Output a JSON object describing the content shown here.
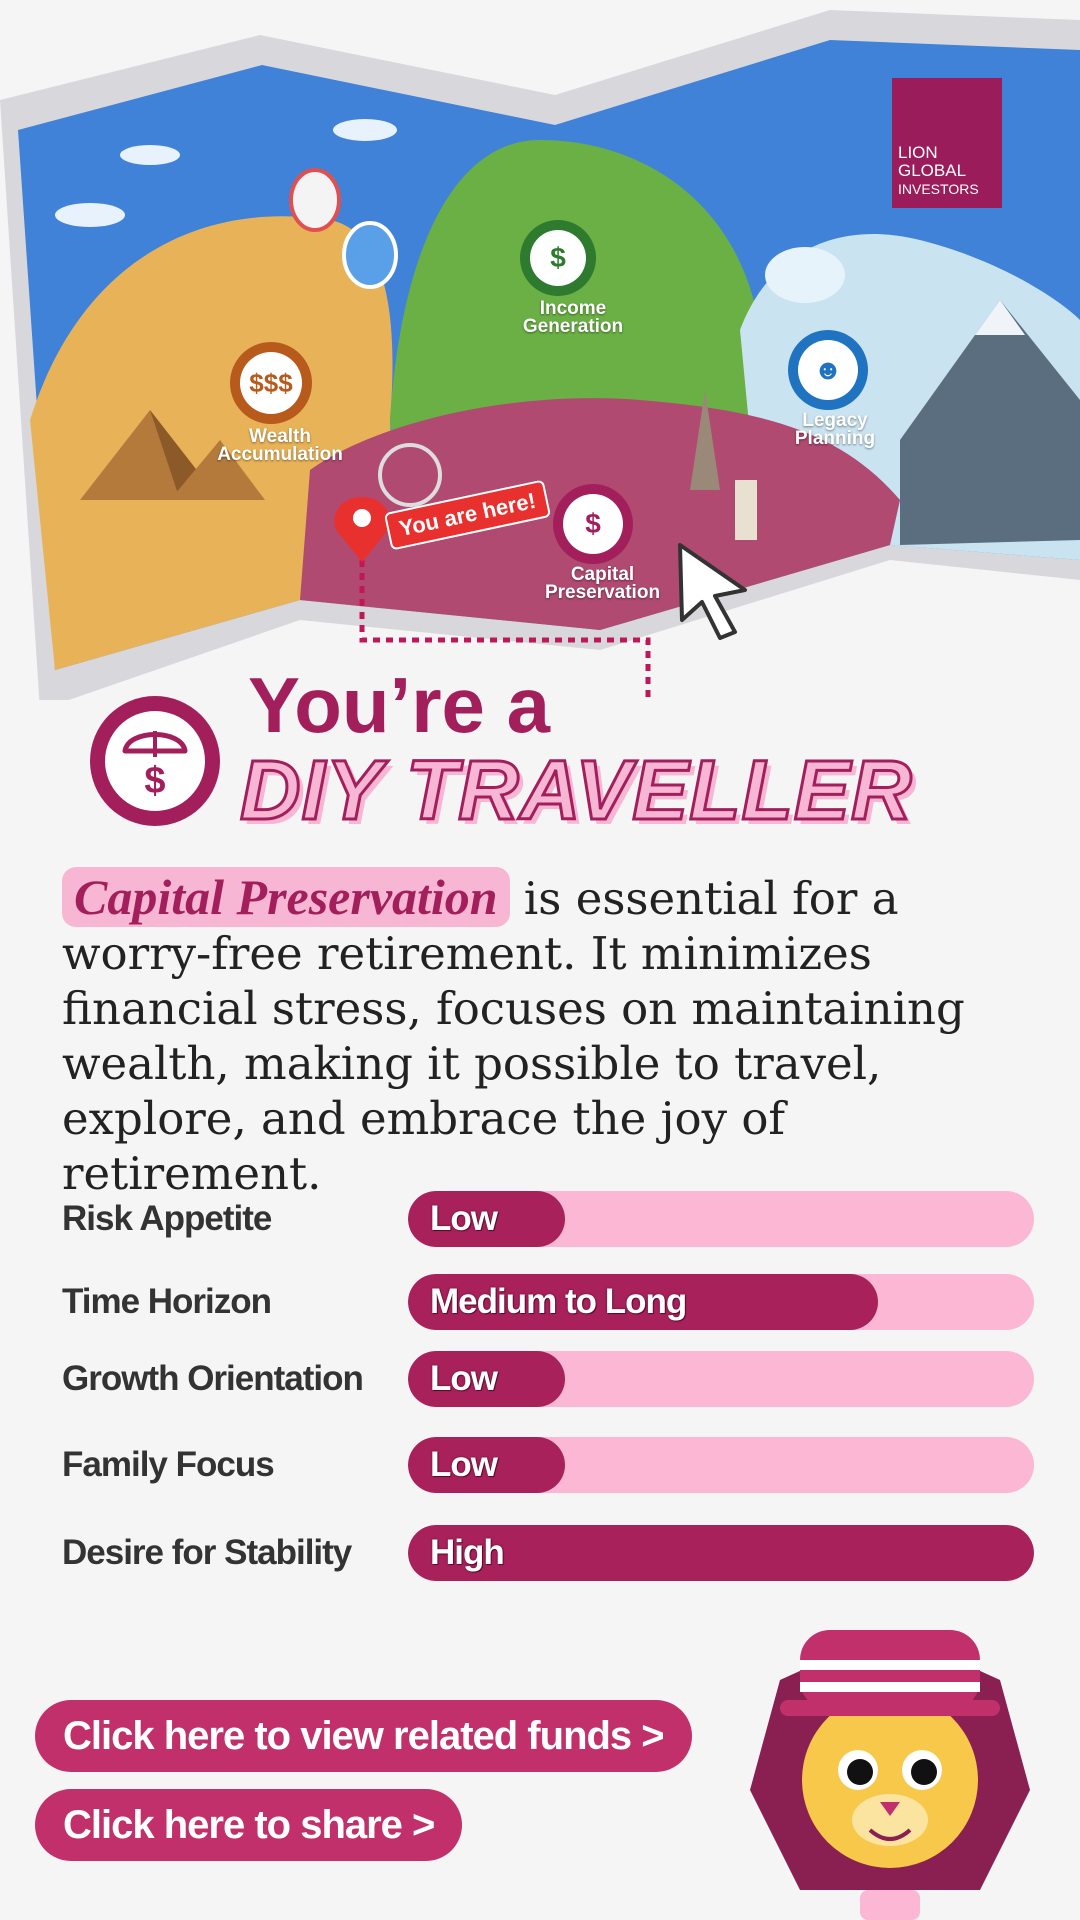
{
  "logo": {
    "line1": "LION",
    "line2": "GLOBAL",
    "line3": "INVESTORS"
  },
  "map": {
    "regions": {
      "wealth": "Wealth Accumulation",
      "income": "Income Generation",
      "legacy": "Legacy Planning",
      "capital": "Capital Preservation"
    },
    "marker": "You are here!",
    "icons": {
      "wealth": "dollar-signs-icon",
      "income": "hand-money-icon",
      "legacy": "family-icon",
      "capital": "umbrella-dollar-icon"
    }
  },
  "result": {
    "prefix": "You’re a",
    "persona": "DIY TRAVELLER",
    "icon": "umbrella-dollar-icon"
  },
  "description": {
    "highlight": "Capital Preservation",
    "text": " is essential for a worry-free retirement. It minimizes financial stress, focuses on maintaining wealth, making it possible to travel, explore, and embrace the joy of retirement."
  },
  "meters": [
    {
      "label": "Risk Appetite",
      "value": "Low",
      "level": 0.25
    },
    {
      "label": "Time Horizon",
      "value": "Medium to Long",
      "level": 0.75
    },
    {
      "label": "Growth Orientation",
      "value": "Low",
      "level": 0.25
    },
    {
      "label": "Family Focus",
      "value": "Low",
      "level": 0.25
    },
    {
      "label": "Desire for Stability",
      "value": "High",
      "level": 1.0
    }
  ],
  "actions": {
    "funds": "Click here to view related funds >",
    "share": "Click here to share  >"
  },
  "colors": {
    "primary": "#a31f5c",
    "track": "#fbb7d4",
    "button": "#c2306b",
    "background": "#f5f5f5"
  }
}
